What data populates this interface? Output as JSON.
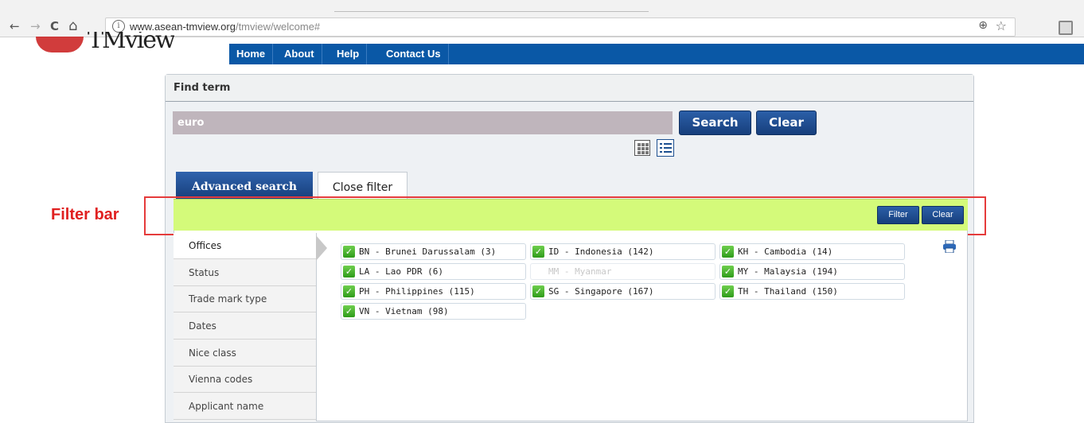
{
  "browser": {
    "url_host": "www.asean-tmview.org",
    "url_path": "/tmview/welcome#",
    "back_glyph": "←",
    "forward_glyph": "→",
    "reload_glyph": "C",
    "home_glyph": "⌂",
    "info_glyph": "i",
    "zoom_glyph": "⊕",
    "star_glyph": "☆"
  },
  "header": {
    "logo_text": "TMview",
    "menu": [
      "Home",
      "About",
      "Help",
      "Contact Us"
    ]
  },
  "find_term": {
    "title": "Find term",
    "query": "euro",
    "search_label": "Search",
    "clear_label": "Clear"
  },
  "tabs": {
    "advanced": "Advanced search",
    "close_filter": "Close filter"
  },
  "filter_bar": {
    "filter_label": "Filter",
    "clear_label": "Clear"
  },
  "annotation": {
    "label": "Filter bar",
    "color": "#e53b3b"
  },
  "sidebar": {
    "items": [
      "Offices",
      "Status",
      "Trade mark type",
      "Dates",
      "Nice class",
      "Vienna codes",
      "Applicant name"
    ]
  },
  "offices": [
    {
      "label": "BN - Brunei Darussalam (3)",
      "checked": true
    },
    {
      "label": "ID - Indonesia (142)",
      "checked": true
    },
    {
      "label": "KH - Cambodia (14)",
      "checked": true
    },
    {
      "label": "LA - Lao PDR (6)",
      "checked": true
    },
    {
      "label": "MM - Myanmar",
      "checked": false
    },
    {
      "label": "MY - Malaysia (194)",
      "checked": true
    },
    {
      "label": "PH - Philippines (115)",
      "checked": true
    },
    {
      "label": "SG - Singapore (167)",
      "checked": true
    },
    {
      "label": "TH - Thailand (150)",
      "checked": true
    },
    {
      "label": "VN - Vietnam (98)",
      "checked": true
    }
  ],
  "colors": {
    "menubar": "#0a58a6",
    "filterbar": "#d4fa7a",
    "button": "#1f4a8a"
  }
}
